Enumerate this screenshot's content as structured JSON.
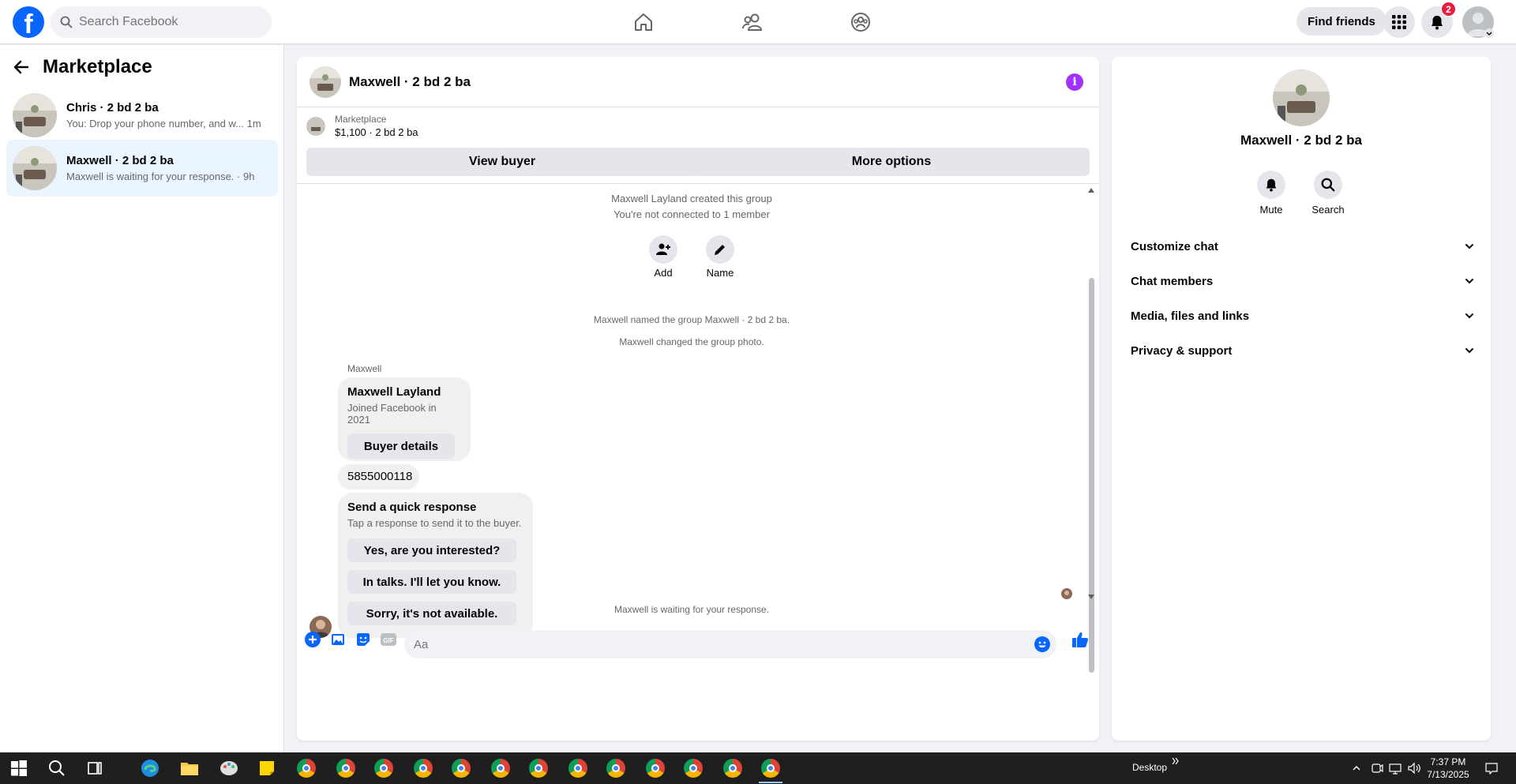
{
  "topbar": {
    "logo_letter": "f",
    "search_placeholder": "Search Facebook",
    "find_friends_label": "Find friends",
    "notification_count": "2"
  },
  "sidebar": {
    "title": "Marketplace",
    "conversations": [
      {
        "title": "Chris · 2 bd 2 ba",
        "preview": "You: Drop your phone number, and w...",
        "time": "1m"
      },
      {
        "title": "Maxwell · 2 bd 2 ba",
        "preview": "Maxwell is waiting for your response.",
        "time": "9h"
      }
    ]
  },
  "chat": {
    "title": "Maxwell · 2 bd 2 ba",
    "info_glyph": "i",
    "listing": {
      "source": "Marketplace",
      "price_title": "$1,100 · 2 bd 2 ba"
    },
    "view_buyer_label": "View buyer",
    "more_options_label": "More options",
    "created_text": "Maxwell Layland created this group",
    "not_connected_text": "You're not connected to 1 member",
    "add_label": "Add",
    "name_label": "Name",
    "named_text": "Maxwell named the group Maxwell · 2 bd 2 ba.",
    "photo_text": "Maxwell changed the group photo.",
    "sender_name": "Maxwell",
    "profile_card": {
      "name": "Maxwell Layland",
      "joined": "Joined Facebook in 2021",
      "button": "Buyer details"
    },
    "phone_message": "5855000118",
    "quick_response": {
      "title": "Send a quick response",
      "subtitle": "Tap a response to send it to the buyer.",
      "options": [
        "Yes, are you interested?",
        "In talks. I'll let you know.",
        "Sorry, it's not available."
      ]
    },
    "waiting_text": "Maxwell is waiting for your response.",
    "composer_placeholder": "Aa",
    "gif_label": "GIF"
  },
  "details": {
    "title": "Maxwell · 2 bd 2 ba",
    "mute_label": "Mute",
    "search_label": "Search",
    "sections": [
      "Customize chat",
      "Chat members",
      "Media, files and links",
      "Privacy & support"
    ]
  },
  "taskbar": {
    "desktop_label": "Desktop",
    "time": "7:37 PM",
    "date": "7/13/2025"
  },
  "colors": {
    "brand_blue": "#0866ff",
    "active_conversation_bg": "#ebf5ff",
    "info_purple": "#a033ff",
    "badge_red": "#e41e3f"
  }
}
